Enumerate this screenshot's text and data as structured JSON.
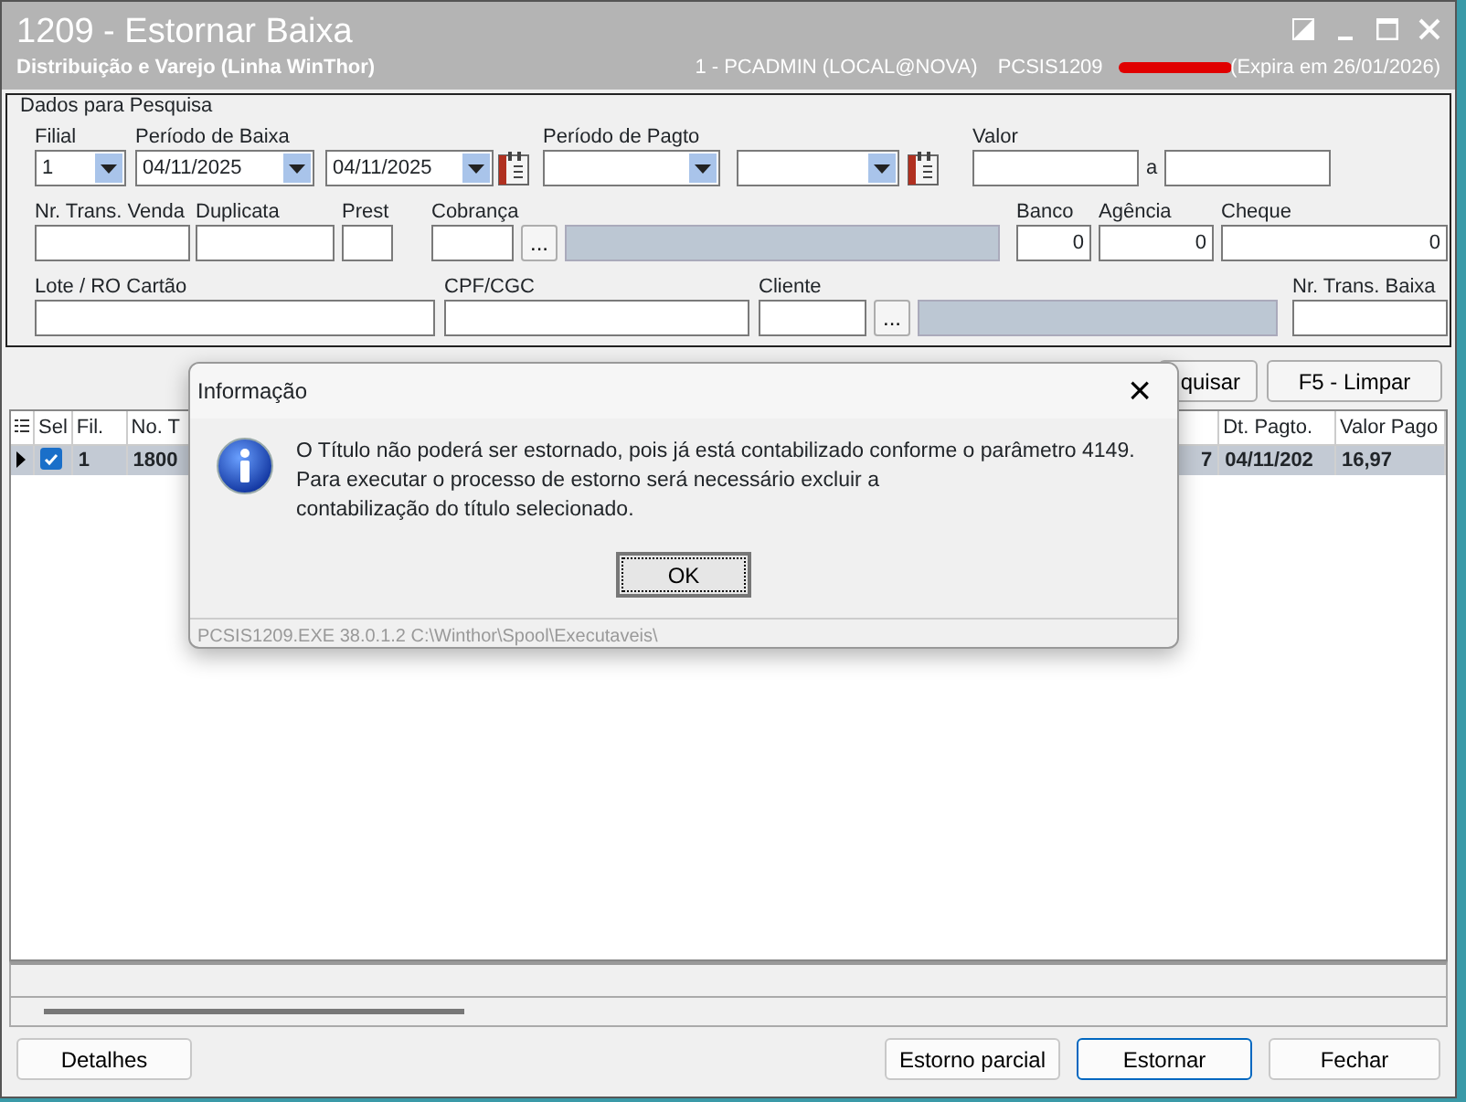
{
  "window": {
    "title": "1209 - Estornar Baixa",
    "subtitle": "Distribuição e Varejo (Linha WinThor)",
    "user": "1 - PCADMIN (LOCAL@NOVA)",
    "program": "PCSIS1209",
    "expiry": "(Expira em 26/01/2026)"
  },
  "filters": {
    "title": "Dados para Pesquisa",
    "groups": [
      {
        "label": "Filial",
        "controls": [
          {
            "kind": "combo",
            "value": "1"
          }
        ]
      },
      {
        "label": "Período de Baixa",
        "controls": [
          {
            "kind": "combo",
            "value": "04/11/2025"
          },
          {
            "kind": "combo",
            "value": "04/11/2025"
          },
          {
            "kind": "calendar"
          }
        ]
      },
      {
        "label": "Período de Pagto",
        "controls": [
          {
            "kind": "combo"
          },
          {
            "kind": "combo"
          },
          {
            "kind": "calendar"
          }
        ]
      },
      {
        "label": "Valor",
        "controls": [
          {
            "kind": "field"
          },
          {
            "kind": "text",
            "value": "a"
          },
          {
            "kind": "field"
          }
        ]
      },
      {
        "label": "Nr. Trans. Venda",
        "controls": [
          {
            "kind": "field"
          }
        ]
      },
      {
        "label": "Duplicata",
        "controls": [
          {
            "kind": "field"
          }
        ]
      },
      {
        "label": "Prest",
        "controls": [
          {
            "kind": "field"
          }
        ]
      },
      {
        "label": "Cobrança",
        "controls": [
          {
            "kind": "field"
          },
          {
            "kind": "lookup",
            "value": "..."
          },
          {
            "kind": "readonly"
          }
        ]
      },
      {
        "label": "Banco",
        "controls": [
          {
            "kind": "number",
            "value": "0"
          }
        ]
      },
      {
        "label": "Agência",
        "controls": [
          {
            "kind": "number",
            "value": "0"
          }
        ]
      },
      {
        "label": "Cheque",
        "controls": [
          {
            "kind": "number",
            "value": "0"
          }
        ]
      },
      {
        "label": "Lote / RO Cartão",
        "controls": [
          {
            "kind": "field"
          }
        ]
      },
      {
        "label": "CPF/CGC",
        "controls": [
          {
            "kind": "field"
          }
        ]
      },
      {
        "label": "Cliente",
        "controls": [
          {
            "kind": "field"
          },
          {
            "kind": "lookup",
            "value": "..."
          },
          {
            "kind": "readonly"
          }
        ]
      },
      {
        "label": "Nr. Trans. Baixa",
        "controls": [
          {
            "kind": "field"
          }
        ]
      }
    ]
  },
  "actions": [
    "quisar",
    "F5 - Limpar"
  ],
  "table": {
    "columns": [
      {
        "label": "Sel"
      },
      {
        "label": "Fil."
      },
      {
        "label": "No. T"
      },
      {},
      {
        "label": "Dt. Pagto."
      },
      {
        "label": "Valor Pago"
      }
    ],
    "rows": [
      {
        "selected": true,
        "cells": [
          {
            "kind": "check",
            "checked": true
          },
          {
            "kind": "text",
            "text": "1"
          },
          {
            "kind": "text",
            "text": "1800"
          },
          {
            "kind": "text",
            "text": "7"
          },
          {
            "kind": "text",
            "text": "04/11/202"
          },
          {
            "kind": "text",
            "text": "16,97"
          }
        ]
      }
    ]
  },
  "buttons": [
    "Detalhes",
    "Estorno parcial",
    "Estornar",
    "Fechar"
  ],
  "dialog": {
    "title": "Informação",
    "close": "×",
    "message": [
      "O Título não poderá ser estornado, pois já está contabilizado conforme o parâmetro 4149.",
      "Para executar o processo de estorno será necessário excluir a",
      "contabilização do título selecionado."
    ],
    "button": "OK",
    "status": "PCSIS1209.EXE 38.0.1.2 C:\\Winthor\\Spool\\Executaveis\\"
  }
}
